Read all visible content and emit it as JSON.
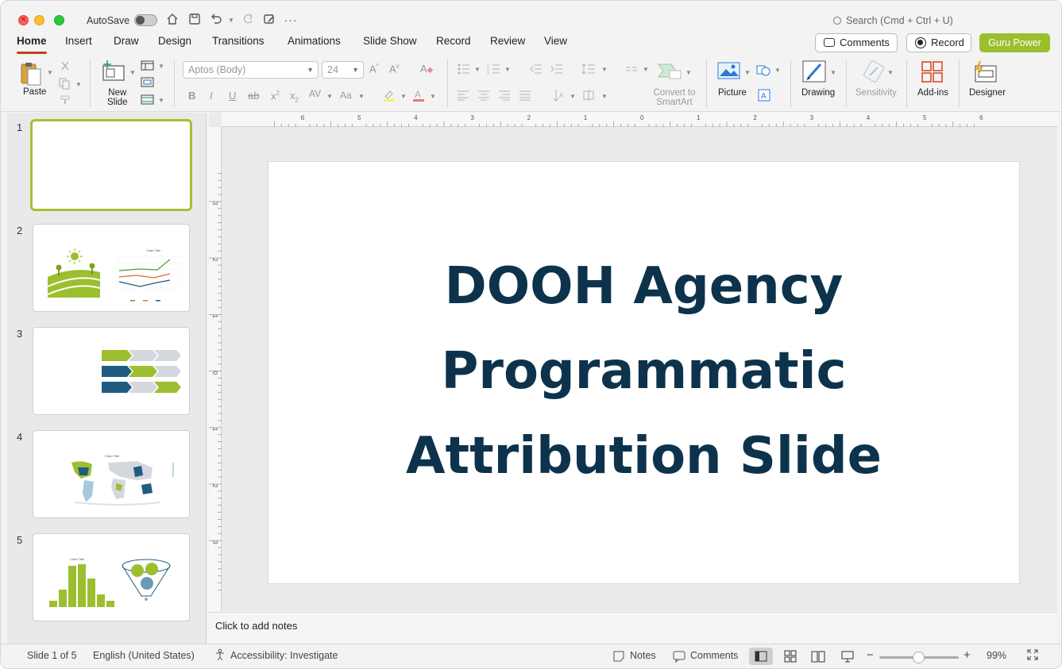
{
  "titlebar": {
    "autosave_label": "AutoSave",
    "search_placeholder": "Search (Cmd + Ctrl + U)"
  },
  "tabs": [
    {
      "label": "Home",
      "active": true
    },
    {
      "label": "Insert"
    },
    {
      "label": "Draw"
    },
    {
      "label": "Design"
    },
    {
      "label": "Transitions"
    },
    {
      "label": "Animations"
    },
    {
      "label": "Slide Show"
    },
    {
      "label": "Record"
    },
    {
      "label": "Review"
    },
    {
      "label": "View"
    }
  ],
  "actions": {
    "comments_label": "Comments",
    "record_label": "Record",
    "guru_label": "Guru Power"
  },
  "ribbon": {
    "paste_label": "Paste",
    "new_slide_label": "New\nSlide",
    "font_name": "Aptos (Body)",
    "font_size": "24",
    "convert_label_1": "Convert to",
    "convert_label_2": "SmartArt",
    "picture_label": "Picture",
    "drawing_label": "Drawing",
    "sensitivity_label": "Sensitivity",
    "addins_label": "Add-ins",
    "designer_label": "Designer"
  },
  "thumbnails": [
    {
      "number": "1",
      "selected": true
    },
    {
      "number": "2",
      "chart_title": "Chart Title"
    },
    {
      "number": "3"
    },
    {
      "number": "4",
      "chart_title": "Chart Title"
    },
    {
      "number": "5",
      "chart_title": "Chart Title"
    }
  ],
  "ruler_h_labels": [
    "6",
    "5",
    "4",
    "3",
    "2",
    "1",
    "0",
    "1",
    "2",
    "3",
    "4",
    "5",
    "6"
  ],
  "ruler_v_labels": [
    "3",
    "2",
    "1",
    "0",
    "1",
    "2",
    "3"
  ],
  "slide": {
    "title_lines": [
      "DOOH Agency",
      "Programmatic",
      "Attribution Slide"
    ],
    "title_color": "#0d334c"
  },
  "notes_placeholder": "Click to add notes",
  "status": {
    "slide_info": "Slide 1 of 5",
    "language": "English (United States)",
    "accessibility": "Accessibility: Investigate",
    "notes_label": "Notes",
    "comments_label": "Comments",
    "zoom": "99%"
  },
  "colors": {
    "accent_green": "#9bbf2e",
    "dark_blue": "#0d334c",
    "mid_blue": "#1f5c82",
    "light_gray": "#d4d8de",
    "tab_underline": "#c43e1c"
  }
}
